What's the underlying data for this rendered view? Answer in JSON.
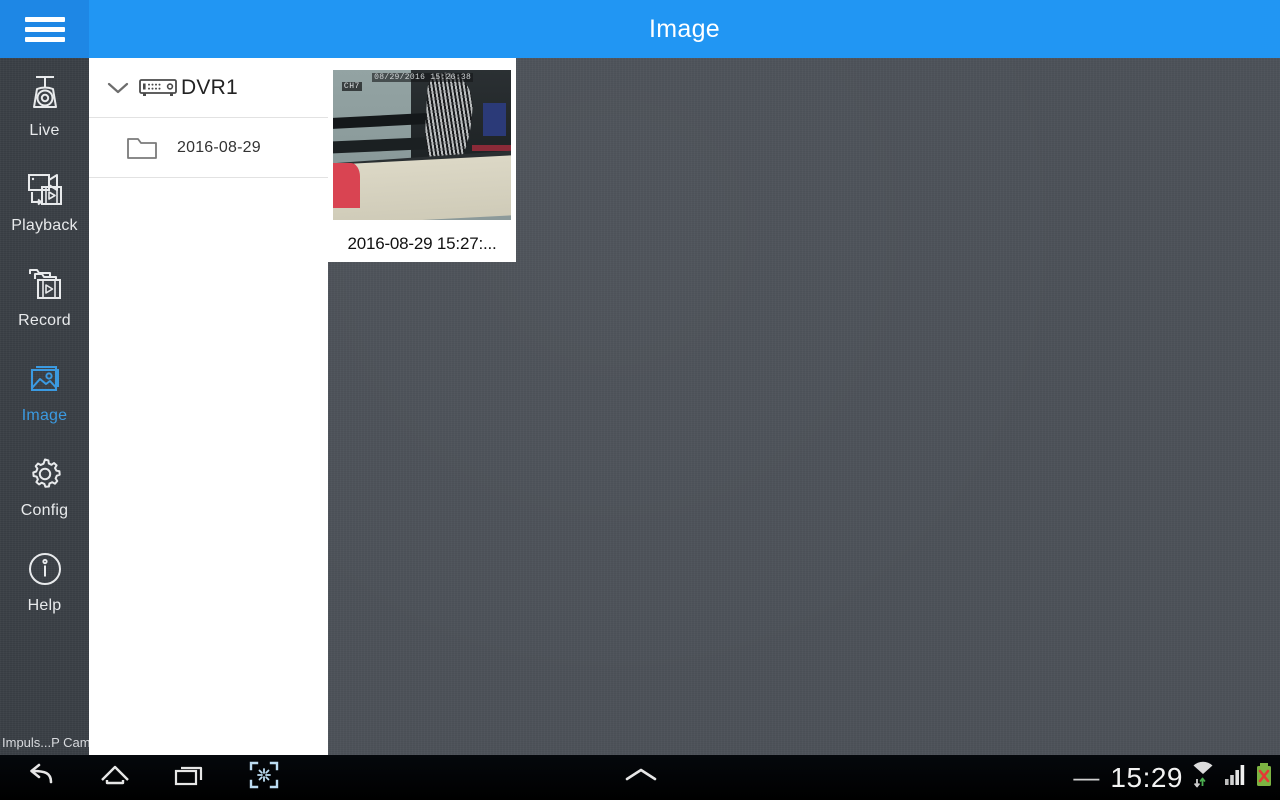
{
  "header": {
    "title": "Image",
    "menu_icon": "hamburger-menu-icon",
    "accent_color": "#2196f3"
  },
  "sidebar": {
    "items": [
      {
        "label": "Live",
        "icon": "dome-camera-icon",
        "active": false
      },
      {
        "label": "Playback",
        "icon": "video-playback-icon",
        "active": false
      },
      {
        "label": "Record",
        "icon": "record-folder-icon",
        "active": false
      },
      {
        "label": "Image",
        "icon": "photo-image-icon",
        "active": true
      },
      {
        "label": "Config",
        "icon": "gear-icon",
        "active": false
      },
      {
        "label": "Help",
        "icon": "info-circle-icon",
        "active": false
      }
    ],
    "app_name": "Impuls...P Cam",
    "active_color": "#3b9ae1",
    "background_color": "#3a3f45"
  },
  "tree": {
    "device": {
      "name": "DVR1",
      "icon": "dvr-device-icon",
      "expand_icon": "chevron-down-icon",
      "expanded": true
    },
    "folders": [
      {
        "name": "2016-08-29",
        "icon": "folder-icon"
      }
    ]
  },
  "gallery": {
    "items": [
      {
        "caption": "2016-08-29  15:27:...",
        "overlay_channel": "CH7",
        "overlay_timestamp": "08/29/2016 15:26:38"
      }
    ],
    "background_color": "#4d5259"
  },
  "navbar": {
    "buttons": [
      {
        "name": "back",
        "icon": "back-arrow-icon"
      },
      {
        "name": "home",
        "icon": "home-icon"
      },
      {
        "name": "recents",
        "icon": "recent-apps-icon"
      },
      {
        "name": "shrink",
        "icon": "shrink-screen-icon"
      },
      {
        "name": "up",
        "icon": "chevron-up-icon"
      }
    ],
    "status": {
      "dash": "—",
      "clock": "15:29",
      "wifi_icon": "wifi-signal-icon",
      "cellular_icon": "cellular-signal-icon",
      "battery_icon": "battery-error-icon"
    }
  }
}
